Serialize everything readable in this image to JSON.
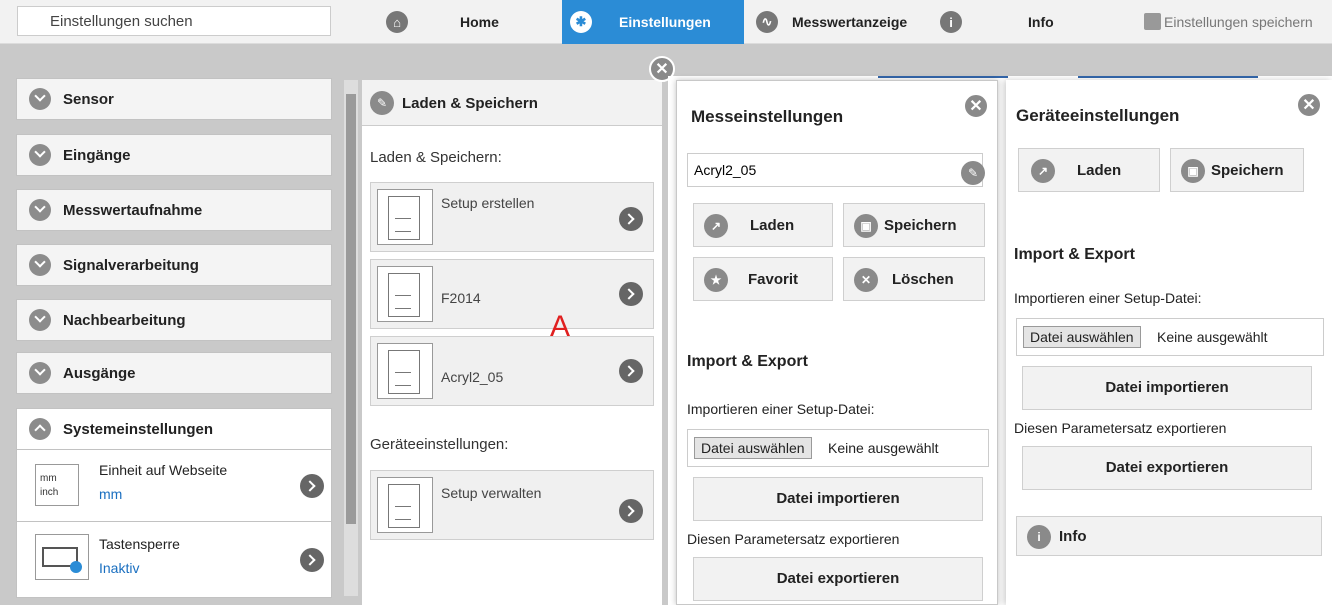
{
  "search": {
    "placeholder": "Einstellungen suchen"
  },
  "nav": {
    "home": "Home",
    "settings": "Einstellungen",
    "values": "Messwertanzeige",
    "info": "Info",
    "save": "Einstellungen speichern"
  },
  "sidebar": {
    "items": [
      "Sensor",
      "Eingänge",
      "Messwertaufnahme",
      "Signalverarbeitung",
      "Nachbearbeitung",
      "Ausgänge",
      "Systemeinstellungen"
    ],
    "sub": [
      {
        "label": "Einheit auf Webseite",
        "value": "mm",
        "icon_mm": "mm",
        "icon_inch": "inch"
      },
      {
        "label": "Tastensperre",
        "value": "Inaktiv"
      }
    ]
  },
  "middle": {
    "title": "Laden & Speichern",
    "section1": "Laden & Speichern:",
    "cards": [
      "Setup erstellen",
      "F2014",
      "Acryl2_05"
    ],
    "section2": "Geräteeinstellungen:",
    "card_manage": "Setup verwalten"
  },
  "annotation": "A",
  "mess": {
    "title": "Messeinstellungen",
    "name_value": "Acryl2_05",
    "load": "Laden",
    "save": "Speichern",
    "favorite": "Favorit",
    "delete": "Löschen",
    "import_title": "Import & Export",
    "import_label": "Importieren einer Setup-Datei:",
    "file_button": "Datei auswählen",
    "file_none": "Keine ausgewählt",
    "import_button": "Datei importieren",
    "export_label": "Diesen Parametersatz exportieren",
    "export_button": "Datei exportieren"
  },
  "device": {
    "title": "Geräteeinstellungen",
    "load": "Laden",
    "save": "Speichern",
    "import_title": "Import & Export",
    "import_label": "Importieren einer Setup-Datei:",
    "file_button": "Datei auswählen",
    "file_none": "Keine ausgewählt",
    "import_button": "Datei importieren",
    "export_label": "Diesen Parametersatz exportieren",
    "export_button": "Datei exportieren",
    "info": "Info"
  },
  "colors": {
    "accent": "#2b8cd6",
    "annotation": "#e02020",
    "value_blue": "#1a6fc0"
  }
}
